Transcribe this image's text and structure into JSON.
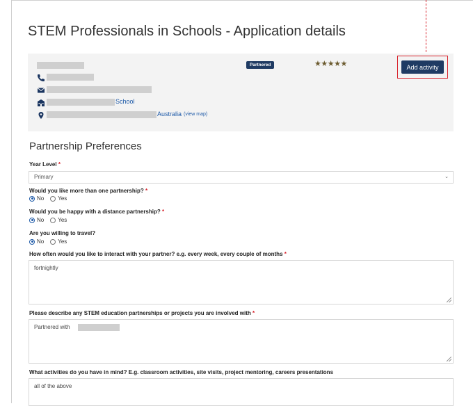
{
  "page": {
    "title": "STEM Professionals in Schools - Application details"
  },
  "card": {
    "badge": "Partnered",
    "rating": "★★★★★",
    "add_activity_label": "Add activity",
    "school_suffix": "School",
    "country": "Australia",
    "view_map": "(view map)",
    "icons": [
      "phone-icon",
      "envelope-icon",
      "school-icon",
      "map-marker-icon"
    ]
  },
  "partnership": {
    "heading": "Partnership Preferences",
    "year_level": {
      "label": "Year Level",
      "value": "Primary"
    },
    "more_than_one": {
      "label": "Would you like more than one partnership?",
      "selected": "No"
    },
    "distance": {
      "label": "Would you be happy with a distance partnership?",
      "selected": "No"
    },
    "travel": {
      "label": "Are you willing to travel?",
      "selected": "No"
    },
    "radio_options": {
      "no": "No",
      "yes": "Yes"
    },
    "interact": {
      "label": "How often would you like to interact with your partner? e.g. every week, every couple of months",
      "value": "fortnightly"
    },
    "describe": {
      "label": "Please describe any STEM education partnerships or projects you are involved with",
      "value": "Partnered with"
    },
    "activities": {
      "label": "What activities do you have in mind? E.g. classroom activities, site visits, project mentoring, careers presentations",
      "value": "all of the above"
    },
    "required_mark": "*"
  },
  "colors": {
    "accent": "#1f3b63",
    "link": "#1e5aa8",
    "required": "#d8202a",
    "highlight": "#d8202a"
  }
}
